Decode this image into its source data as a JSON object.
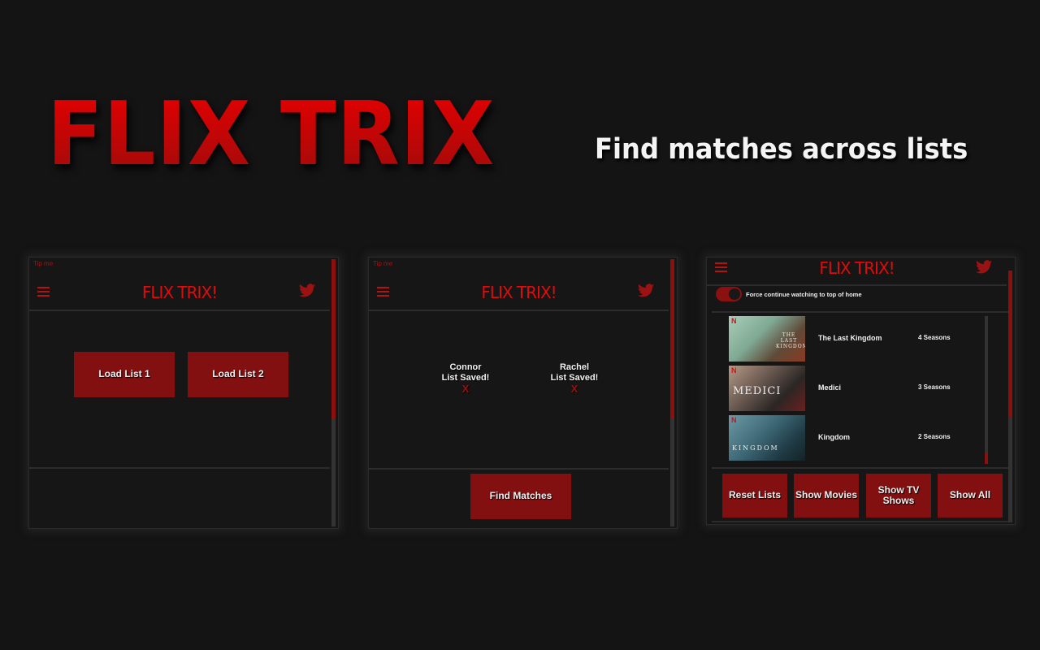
{
  "hero": {
    "title": "FLIX TRIX",
    "subtitle": "Find matches across lists"
  },
  "app": {
    "title": "FLIX TRIX!",
    "tip_label": "Tip me",
    "menu_icon": "hamburger-icon",
    "social_icon": "twitter-icon"
  },
  "screen1": {
    "buttons": [
      "Load List 1",
      "Load List 2"
    ]
  },
  "screen2": {
    "saved": [
      {
        "name": "Connor",
        "status": "List Saved!",
        "remove": "X"
      },
      {
        "name": "Rachel",
        "status": "List Saved!",
        "remove": "X"
      }
    ],
    "find_button": "Find Matches"
  },
  "screen3": {
    "toggle_label": "Force continue watching to top of home",
    "toggle_on": true,
    "results": [
      {
        "title": "The Last Kingdom",
        "seasons": "4 Seasons",
        "thumb_text": "THE LAST KINGDOM"
      },
      {
        "title": "Medici",
        "seasons": "3 Seasons",
        "thumb_text": "MEDICI"
      },
      {
        "title": "Kingdom",
        "seasons": "2 Seasons",
        "thumb_text": "KINGDOM"
      }
    ],
    "buttons": [
      "Reset Lists",
      "Show Movies",
      "Show TV Shows",
      "Show All"
    ]
  },
  "colors": {
    "accent": "#821010",
    "brand_red": "#e00b0b",
    "background": "#141414"
  }
}
